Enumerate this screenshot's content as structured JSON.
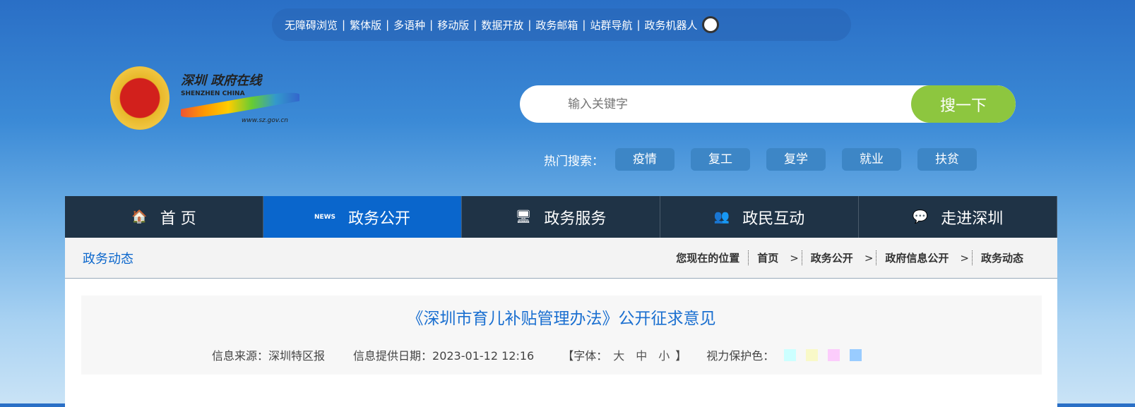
{
  "top_links": [
    "无障碍浏览",
    "|",
    "繁体版",
    "|",
    "多语种",
    "|",
    "移动版",
    "|",
    "数据开放",
    "|",
    "政务邮箱",
    "|",
    "站群导航",
    "|",
    "政务机器人"
  ],
  "logo": {
    "cn": "深圳 政府在线",
    "en": "SHENZHEN CHINA",
    "url": "www.sz.gov.cn"
  },
  "search": {
    "placeholder": "输入关键字",
    "button": "搜一下"
  },
  "hot": {
    "label": "热门搜索：",
    "tags": [
      "疫情",
      "复工",
      "复学",
      "就业",
      "扶贫"
    ]
  },
  "nav": [
    {
      "label": "首 页",
      "icon": "🏠"
    },
    {
      "label": "政务公开",
      "icon": "NEWS"
    },
    {
      "label": "政务服务",
      "icon": "🖥"
    },
    {
      "label": "政民互动",
      "icon": "👥"
    },
    {
      "label": "走进深圳",
      "icon": "💬"
    }
  ],
  "section": "政务动态",
  "breadcrumb": {
    "label": "您现在的位置",
    "items": [
      "首页",
      "政务公开",
      "政府信息公开",
      "政务动态"
    ],
    "sep": ">"
  },
  "article": {
    "title": "《深圳市育儿补贴管理办法》公开征求意见",
    "source": "信息来源：深圳特区报",
    "date": "信息提供日期：2023-01-12 12:16",
    "font_open": "【字体：",
    "font_sizes": [
      "大",
      "中",
      "小"
    ],
    "font_close": "】",
    "eye_label": "视力保护色：",
    "eye_colors": [
      "#ccffff",
      "#f9f9c8",
      "#fcccfc",
      "#99ccff"
    ]
  }
}
